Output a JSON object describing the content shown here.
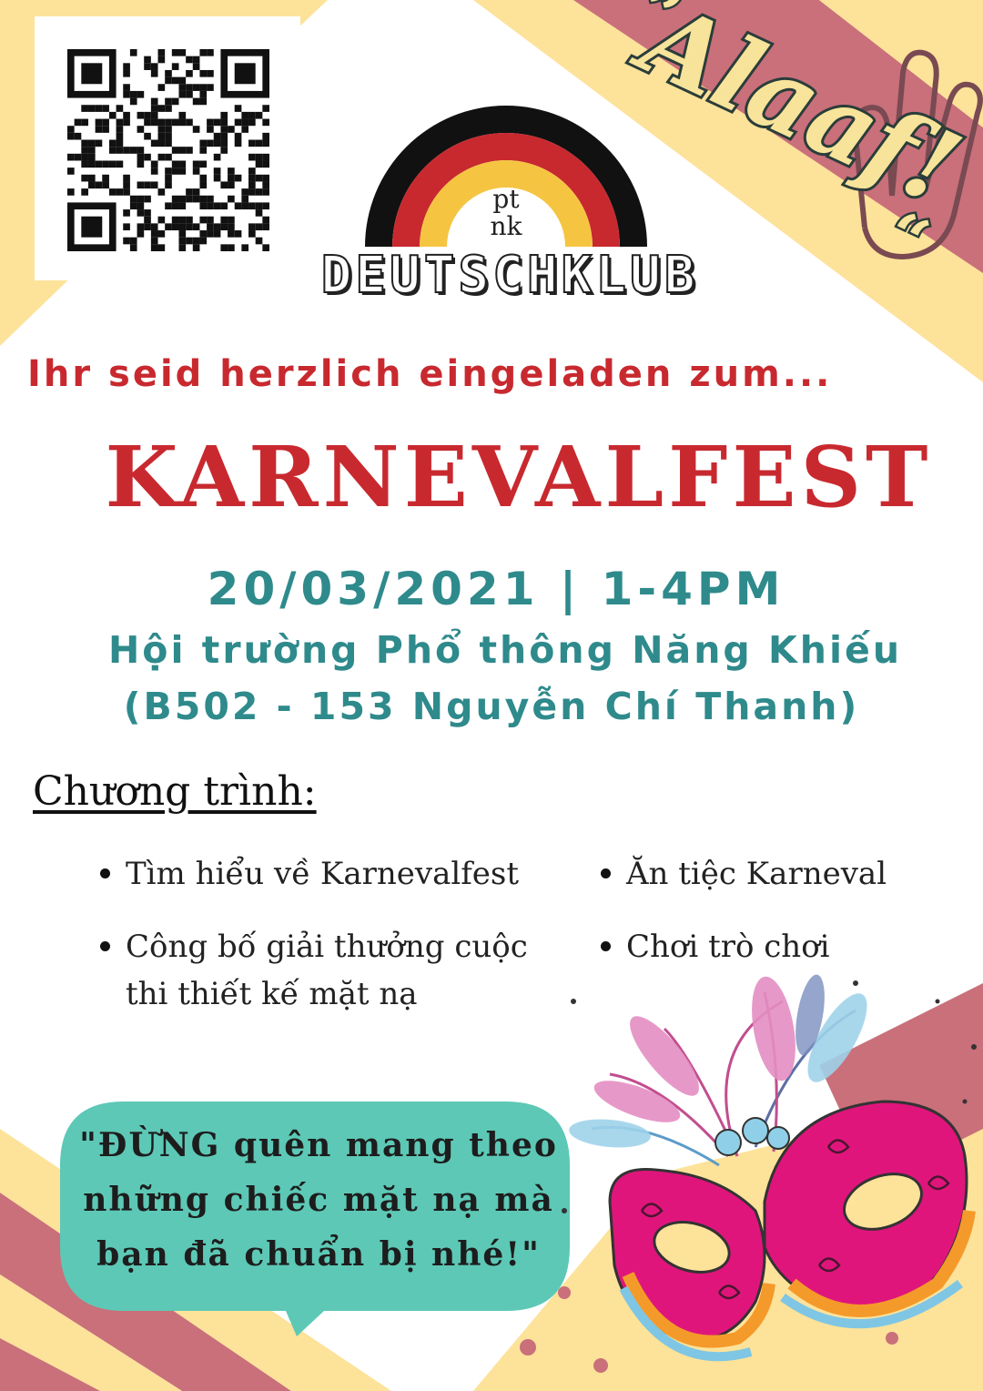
{
  "qr": {
    "icon": "qr-code"
  },
  "logo": {
    "icon": "german-flag-rainbow",
    "monogram_top": "pt",
    "monogram_bottom": "nk",
    "club_name": "DEUTSCHKLUB"
  },
  "greeting": {
    "open_quote": "„",
    "word": "Alaaf!",
    "close_quote": "“",
    "icon": "raised-hand-icon"
  },
  "invite_text": "Ihr seid herzlich eingeladen zum...",
  "event_title": "KARNEVALFEST",
  "date_line": "20/03/2021 | 1-4PM",
  "venue_line": "Hội trường Phổ thông Năng Khiếu",
  "address_line": "(B502 - 153 Nguyễn Chí Thanh)",
  "program": {
    "heading": "Chương trình:",
    "items": [
      "Tìm hiểu về Karnevalfest",
      "Công bố giải thưởng cuộc thi thiết kế mặt nạ",
      "Ăn tiệc Karneval",
      "Chơi trò chơi"
    ]
  },
  "reminder": "\"ĐỪNG quên mang theo những chiếc mặt nạ mà bạn đã chuẩn bị nhé!\"",
  "decoration": {
    "icon": "carnival-mask-icon"
  },
  "colors": {
    "red": "#c8292f",
    "teal": "#2f8a8c",
    "bubble": "#5dc8b6",
    "stripe_pink": "#c9707a",
    "stripe_yellow": "#fde29a",
    "mask_pink": "#e0157c"
  }
}
